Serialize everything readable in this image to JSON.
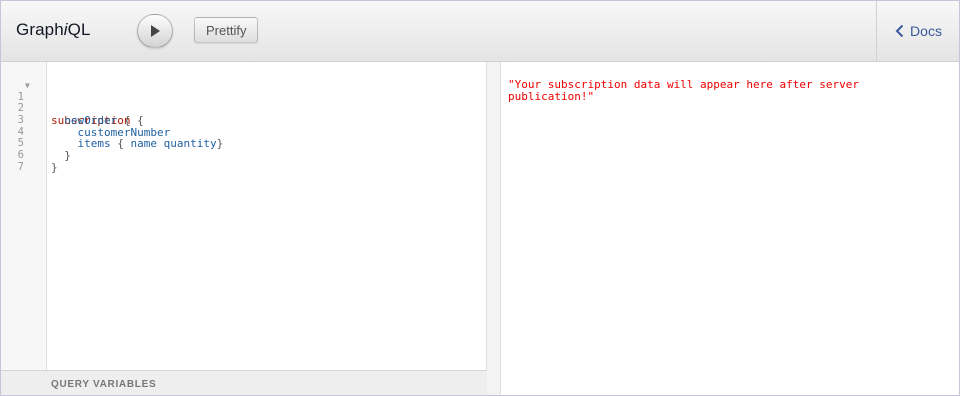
{
  "app": {
    "title_prefix": "Graph",
    "title_italic": "i",
    "title_suffix": "QL"
  },
  "toolbar": {
    "run_icon": "play-icon",
    "prettify_label": "Prettify"
  },
  "docs": {
    "icon": "chevron-left-icon",
    "label": "Docs"
  },
  "editor": {
    "line_numbers": [
      "1",
      "2",
      "3",
      "4",
      "5",
      "6",
      "7"
    ],
    "fold_icon": "fold-arrow-icon",
    "lines": {
      "l1_keyword": "subscription",
      "l1_brace": "{",
      "l2_field": "newOrder",
      "l2_brace": "{",
      "l3_field": "customerNumber",
      "l4_field1": "items",
      "l4_open": "{",
      "l4_field2": "name",
      "l4_field3": "quantity",
      "l4_close": "}",
      "l5_brace": "}",
      "l6_brace": "}"
    }
  },
  "variables": {
    "label": "QUERY VARIABLES"
  },
  "result": {
    "text": "\"Your subscription data will appear here after server\npublication!\""
  },
  "colors": {
    "keyword": "#B11A04",
    "property": "#1F61A0",
    "result": "#f00000",
    "docs_link": "#3B5998"
  }
}
